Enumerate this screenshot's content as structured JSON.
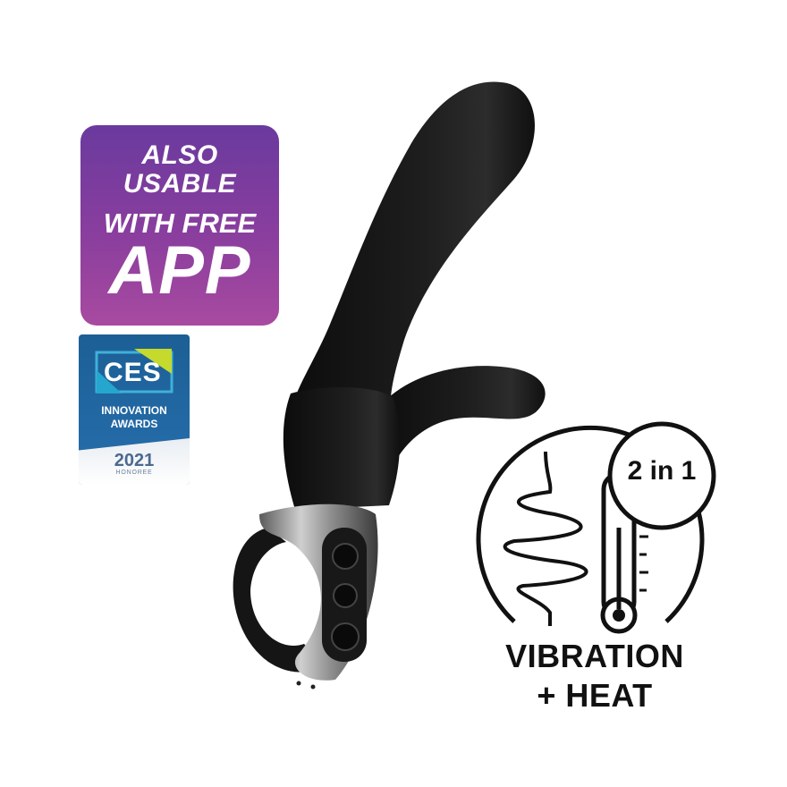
{
  "app_badge": {
    "line1": "ALSO",
    "line2": "USABLE",
    "line3": "WITH FREE",
    "line4": "APP"
  },
  "ces_badge": {
    "logo": "CES",
    "line1": "INNOVATION",
    "line2": "AWARDS",
    "year": "2021",
    "honoree": "HONOREE"
  },
  "feature": {
    "badge": "2 in 1",
    "line1": "VIBRATION",
    "line2": "+ HEAT"
  }
}
